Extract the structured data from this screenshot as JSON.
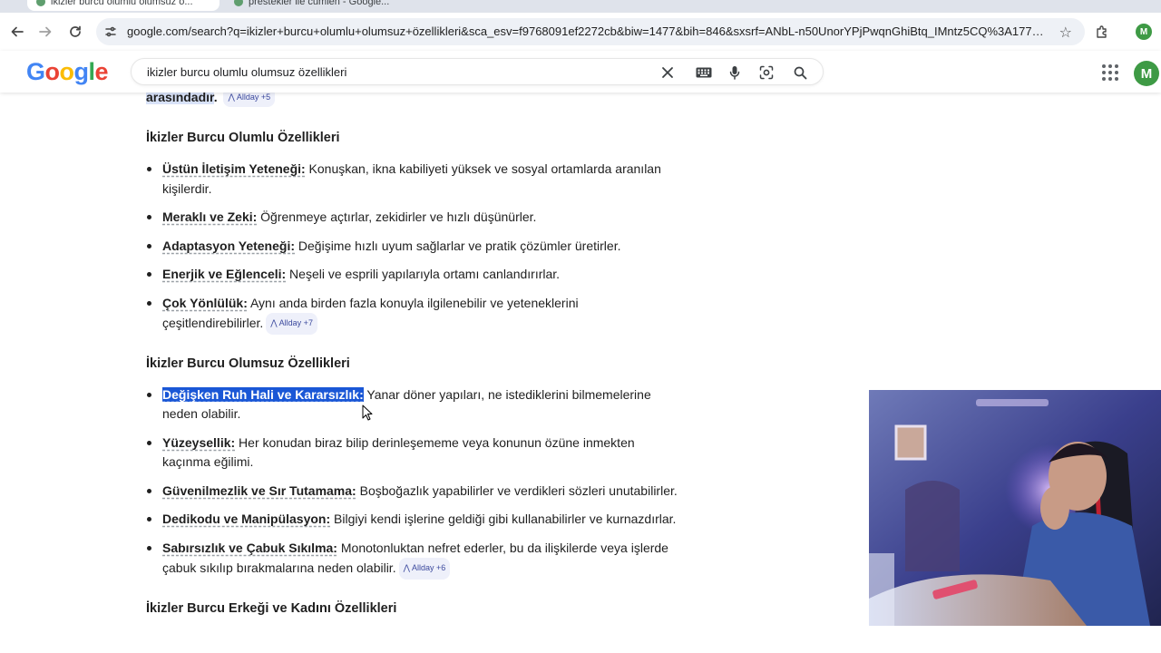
{
  "browser": {
    "tabs": [
      {
        "label": "ikizler burcu olumlu olumsuz ö..."
      },
      {
        "label": "prestekler ile cümlen - Google..."
      }
    ],
    "url": "google.com/search?q=ikizler+burcu+olumlu+olumsuz+özellikleri&sca_esv=f9768091ef2272cb&biw=1477&bih=846&sxsrf=ANbL-n50UnorYPjPwqnGhiBtq_IMntz5CQ%3A177464533...",
    "profile_initial": "M"
  },
  "search": {
    "logo": "Google",
    "query": "ikizler burcu olumlu olumsuz özellikleri",
    "avatar_initial": "M"
  },
  "article": {
    "top_text": "arasındadır",
    "top_chip": "Allday +5",
    "sections": [
      {
        "heading": "İkizler Burcu Olumlu Özellikleri",
        "items": [
          {
            "term": "Üstün İletişim Yeteneği:",
            "text": " Konuşkan, ikna kabiliyeti yüksek ve sosyal ortamlarda aranılan kişilerdir."
          },
          {
            "term": "Meraklı ve Zeki:",
            "text": " Öğrenmeye açtırlar, zekidirler ve hızlı düşünürler."
          },
          {
            "term": "Adaptasyon Yeteneği:",
            "text": " Değişime hızlı uyum sağlarlar ve pratik çözümler üretirler."
          },
          {
            "term": "Enerjik ve Eğlenceli:",
            "text": " Neşeli ve esprili yapılarıyla ortamı canlandırırlar."
          },
          {
            "term": "Çok Yönlülük:",
            "text": " Aynı anda birden fazla konuyla ilgilenebilir ve yeteneklerini çeşitlendirebilirler.",
            "chip": "Allday +7"
          }
        ]
      },
      {
        "heading": "İkizler Burcu Olumsuz Özellikleri",
        "items": [
          {
            "term": "Değişken Ruh Hali ve Kararsızlık:",
            "text": " Yanar döner yapıları, ne istediklerini bilmemelerine neden olabilir."
          },
          {
            "term": "Yüzeysellik:",
            "text": " Her konudan biraz bilip derinleşememe veya konunun özüne inmekten kaçınma eğilimi."
          },
          {
            "term": "Güvenilmezlik ve Sır Tutamama:",
            "text": " Boşboğazlık yapabilirler ve verdikleri sözleri unutabilirler."
          },
          {
            "term": "Dedikodu ve Manipülasyon:",
            "text": " Bilgiyi kendi işlerine geldiği gibi kullanabilirler ve kurnazdırlar."
          },
          {
            "term": "Sabırsızlık ve Çabuk Sıkılma:",
            "text": " Monotonluktan nefret ederler, bu da ilişkilerde veya işlerde çabuk sıkılıp bırakmalarına neden olabilir.",
            "chip": "Allday +6"
          }
        ]
      }
    ],
    "next_heading": "İkizler Burcu Erkeği ve Kadını Özellikleri"
  },
  "colors": {
    "selection": "#1a57d6",
    "chip_bg": "#eef0fa",
    "chip_text": "#3c4a9e",
    "avatar": "#3e9a45"
  },
  "icons": [
    "back-arrow-icon",
    "forward-arrow-icon",
    "reload-icon",
    "site-info-icon",
    "star-icon",
    "extensions-icon",
    "clear-icon",
    "keyboard-icon",
    "mic-icon",
    "lens-icon",
    "search-icon",
    "apps-grid-icon",
    "mouse-cursor-icon"
  ]
}
